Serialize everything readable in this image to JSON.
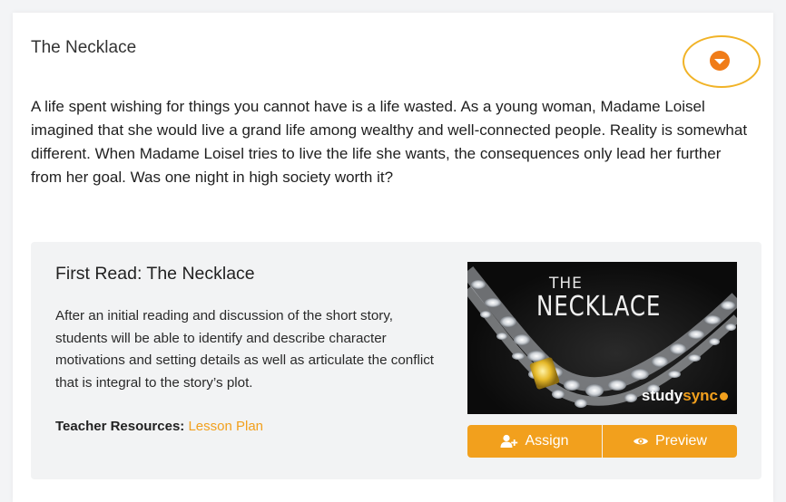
{
  "section": {
    "title": "The Necklace",
    "description": "A life spent wishing for things you cannot have is a life wasted. As a young woman, Madame Loisel imagined that she would live a grand life among wealthy and well-connected people. Reality is somewhat different. When Madame Loisel tries to live the life she wants, the consequences only lead her further from her goal. Was one night in high society worth it?",
    "toggle_icon": "chevron-down-icon"
  },
  "lesson": {
    "title": "First Read: The Necklace",
    "description": "After an initial reading and discussion of the short story, students will be able to identify and describe character motivations and setting details as well as articulate the conflict that is integral to the story’s plot.",
    "resources_label": "Teacher Resources:",
    "resources_link": "Lesson Plan",
    "cover": {
      "title_small": "THE",
      "title_large": "NECKLACE",
      "brand_study": "study",
      "brand_sync": "sync"
    },
    "buttons": {
      "assign_label": "Assign",
      "assign_icon": "add-user-icon",
      "preview_label": "Preview",
      "preview_icon": "eye-icon"
    }
  },
  "colors": {
    "accent": "#f2a01d",
    "toggle": "#f07c18",
    "highlight_ring": "#f1b327",
    "panel_bg": "#f2f3f4"
  }
}
